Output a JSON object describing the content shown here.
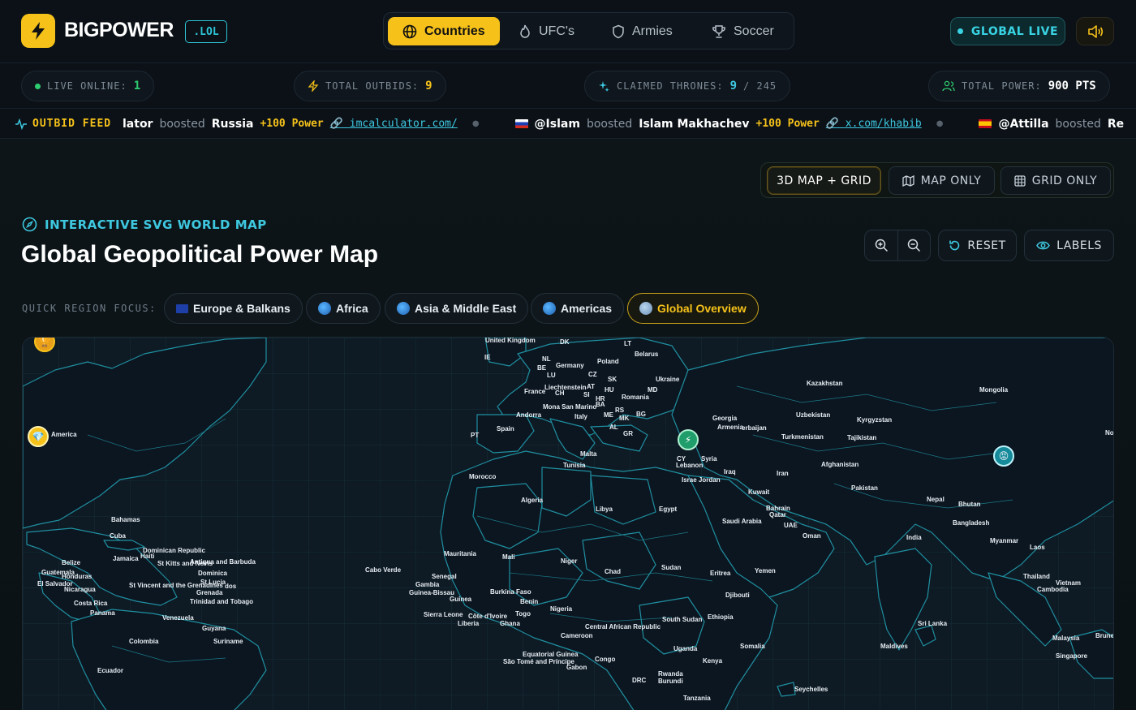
{
  "header": {
    "brand": "BIGPOWER",
    "tld": ".LOL",
    "nav": [
      {
        "label": "Countries",
        "icon": "globe-icon",
        "active": true
      },
      {
        "label": "UFC's",
        "icon": "flame-icon",
        "active": false
      },
      {
        "label": "Armies",
        "icon": "shield-icon",
        "active": false
      },
      {
        "label": "Soccer",
        "icon": "trophy-icon",
        "active": false
      }
    ],
    "live_label": "GLOBAL LIVE",
    "sound_icon": "speaker-icon"
  },
  "stats": [
    {
      "label": "LIVE ONLINE:",
      "value": "1",
      "color": "#2ecc71"
    },
    {
      "label": "TOTAL OUTBIDS:",
      "value": "9",
      "color": "#f6c21a"
    },
    {
      "label": "CLAIMED THRONES:",
      "value": "9",
      "total": "/ 245",
      "color": "#3ec8e0"
    },
    {
      "label": "TOTAL POWER:",
      "value": "900 PTS",
      "color": "#ffffff"
    }
  ],
  "ticker": {
    "label": "OUTBID FEED",
    "items": [
      {
        "user": "lator",
        "verb": "boosted",
        "target": "Russia",
        "power": "+100 Power",
        "link": "imcalculator.com/"
      },
      {
        "user": "@Islam",
        "verb": "boosted",
        "target": "Islam Makhachev",
        "power": "+100 Power",
        "link": "x.com/khabib"
      },
      {
        "user": "@Attilla",
        "verb": "boosted",
        "target": "Re",
        "power": "",
        "link": ""
      }
    ]
  },
  "views": {
    "options": [
      "3D MAP + GRID",
      "MAP ONLY",
      "GRID ONLY"
    ],
    "active": "3D MAP + GRID"
  },
  "map_section": {
    "eyebrow": "INTERACTIVE SVG WORLD MAP",
    "title": "Global Geopolitical Power Map",
    "reset": "RESET",
    "labels": "LABELS",
    "quick_label": "QUICK REGION FOCUS:",
    "regions": [
      {
        "label": "Europe & Balkans",
        "active": false
      },
      {
        "label": "Africa",
        "active": false
      },
      {
        "label": "Asia & Middle East",
        "active": false
      },
      {
        "label": "Americas",
        "active": false
      },
      {
        "label": "Global Overview",
        "active": true
      }
    ]
  },
  "map_labels": {
    "united_kingdom": "United Kingdom",
    "dk": "DK",
    "lt": "LT",
    "belarus": "Belarus",
    "ie": "IE",
    "nl": "NL",
    "poland": "Poland",
    "be": "BE",
    "germany": "Germany",
    "lu": "LU",
    "cz": "CZ",
    "ukraine": "Ukraine",
    "sk": "SK",
    "liechtenstein": "Liechtenstein",
    "at": "AT",
    "ch": "CH",
    "hu": "HU",
    "france": "France",
    "si": "SI",
    "md": "MD",
    "hr": "HR",
    "romania": "Romania",
    "ba": "BA",
    "rs": "RS",
    "mona_san_marino": "Mona San Marino",
    "andorra": "Andorra",
    "italy": "Italy",
    "me": "ME",
    "mk": "MK",
    "bg": "BG",
    "al": "AL",
    "gr": "GR",
    "spain": "Spain",
    "pt": "PT",
    "malta": "Malta",
    "tunisia": "Tunisia",
    "morocco": "Morocco",
    "algeria": "Algeria",
    "libya": "Libya",
    "egypt": "Egypt",
    "cy": "CY",
    "lebanon": "Lebanon",
    "syria": "Syria",
    "israel_jordan": "Israe Jordan",
    "iraq": "Iraq",
    "iran": "Iran",
    "kuwait": "Kuwait",
    "bahrain": "Bahrain",
    "qatar": "Qatar",
    "uae": "UAE",
    "saudi_arabia": "Saudi Arabia",
    "oman": "Oman",
    "yemen": "Yemen",
    "georgia": "Georgia",
    "armenia": "Armenia",
    "azerbaijan": "erbaijan",
    "kazakhstan": "Kazakhstan",
    "uzbekistan": "Uzbekistan",
    "turkmenistan": "Turkmenistan",
    "kyrgyzstan": "Kyrgyzstan",
    "tajikistan": "Tajikistan",
    "afghanistan": "Afghanistan",
    "pakistan": "Pakistan",
    "mongolia": "Mongolia",
    "nepal": "Nepal",
    "bhutan": "Bhutan",
    "bangladesh": "Bangladesh",
    "india": "India",
    "myanmar": "Myanmar",
    "laos": "Laos",
    "thailand": "Thailand",
    "vietnam": "Vietnam",
    "cambodia": "Cambodia",
    "sri_lanka": "Sri Lanka",
    "maldives": "Maldives",
    "malaysia": "Malaysia",
    "singapore": "Singapore",
    "brune": "Brune",
    "nor": "Nor",
    "mauritania": "Mauritania",
    "mali": "Mali",
    "niger": "Niger",
    "chad": "Chad",
    "sudan": "Sudan",
    "eritrea": "Eritrea",
    "djibouti": "Djibouti",
    "ethiopia": "Ethiopia",
    "somalia": "Somalia",
    "south_sudan": "South Sudan",
    "car": "Central African Republic",
    "cameroon": "Cameroon",
    "nigeria": "Nigeria",
    "benin": "Benin",
    "togo": "Togo",
    "ghana": "Ghana",
    "cote": "Côte d'Ivoire",
    "liberia": "Liberia",
    "sierra_leone": "Sierra Leone",
    "guinea": "Guinea",
    "guinea_bissau": "Guinea-Bissau",
    "gambia": "Gambia",
    "senegal": "Senegal",
    "burkina": "Burkina Faso",
    "cabo_verde": "Cabo Verde",
    "eq_guinea": "Equatorial Guinea",
    "sao_tome": "São Tomé and Príncipe",
    "gabon": "Gabon",
    "congo": "Congo",
    "drc": "DRC",
    "uganda": "Uganda",
    "kenya": "Kenya",
    "rwanda": "Rwanda",
    "burundi": "Burundi",
    "tanzania": "Tanzania",
    "seychelles": "Seychelles",
    "america": "America",
    "bahamas": "Bahamas",
    "cuba": "Cuba",
    "dominican": "Dominican Republic",
    "haiti": "Haiti",
    "jamaica": "Jamaica",
    "st_kitts": "St Kitts and Nevis",
    "antigua": "Antigua and Barbuda",
    "dominica": "Dominica",
    "st_lucia": "St Lucia",
    "st_vincent": "St Vincent and the Grenadines",
    "barbados": "dos",
    "grenada": "Grenada",
    "trinidad": "Trinidad and Tobago",
    "belize": "Belize",
    "guatemala": "Guatemala",
    "honduras": "Honduras",
    "el_salvador": "El Salvador",
    "nicaragua": "Nicaragua",
    "costa_rica": "Costa Rica",
    "panama": "Panama",
    "venezuela": "Venezuela",
    "guyana": "Guyana",
    "suriname": "Suriname",
    "colombia": "Colombia",
    "ecuador": "Ecuador"
  },
  "colors": {
    "accent": "#f6c21a",
    "cyan": "#3ec8e0",
    "border": "#1f8fa0"
  }
}
